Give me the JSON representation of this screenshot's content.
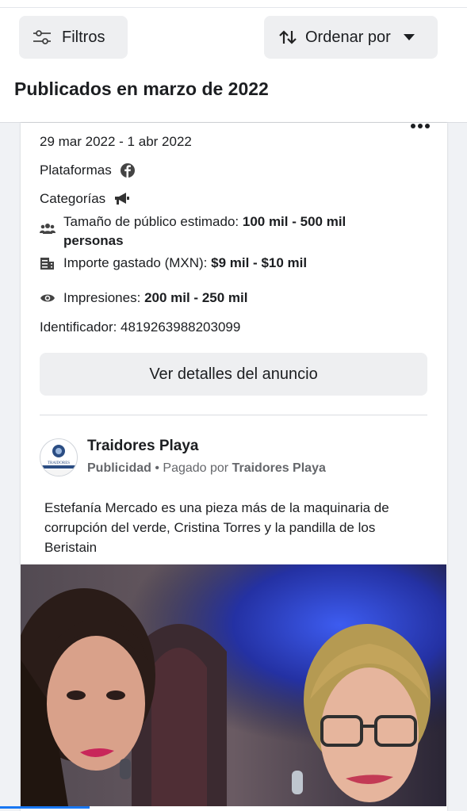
{
  "toolbar": {
    "filters_label": "Filtros",
    "sort_label": "Ordenar por"
  },
  "section_title": "Publicados en marzo de 2022",
  "ad": {
    "date_range": "29 mar 2022 - 1 abr 2022",
    "platforms_label": "Plataformas",
    "categories_label": "Categorías",
    "audience_label": "Tamaño de público estimado: ",
    "audience_value": "100 mil - 500 mil",
    "audience_value_2": "personas",
    "spend_label": "Importe gastado (MXN): ",
    "spend_value": "$9 mil - $10 mil",
    "impressions_label": "Impresiones: ",
    "impressions_value": "200 mil - 250 mil",
    "id_label": "Identificador: 4819263988203099",
    "details_button": "Ver detalles del anuncio"
  },
  "post": {
    "page_name": "Traidores Playa",
    "sponsored": "Publicidad",
    "paid_by_prefix": " • Pagado por ",
    "paid_by": "Traidores Playa",
    "avatar_text": "TRAIDORES",
    "text": "Estefanía Mercado es una pieza más de la maquinaria de corrupción del verde, Cristina Torres y la pandilla de los Beristain"
  },
  "colors": {
    "accent": "#1877f2",
    "button_bg": "#eeeff1",
    "secondary_text": "#65676b"
  },
  "icons": [
    "filter-sliders-icon",
    "sort-arrows-icon",
    "caret-down-icon",
    "more-dots-icon",
    "facebook-icon",
    "megaphone-icon",
    "people-icon",
    "money-icon",
    "eye-icon"
  ]
}
